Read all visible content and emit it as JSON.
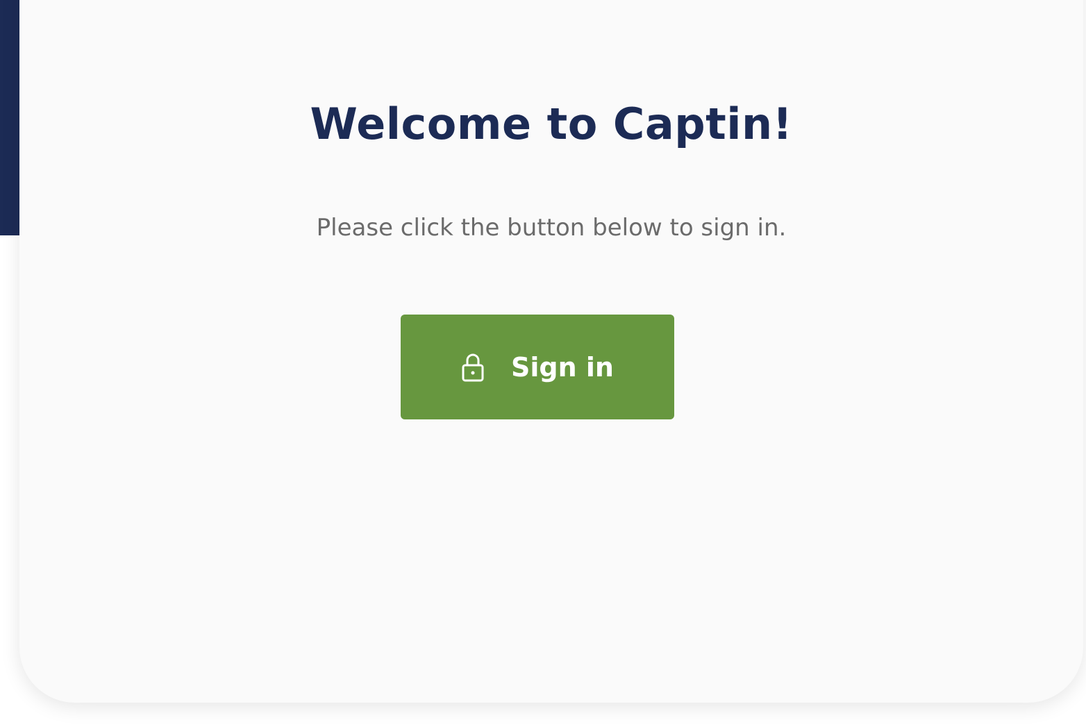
{
  "welcome": {
    "title": "Welcome to Captin!",
    "subtitle": "Please click the button below to sign in."
  },
  "signin": {
    "label": "Sign in",
    "icon": "lock-icon"
  },
  "colors": {
    "accent_navy": "#1c2b55",
    "button_green": "#67973f",
    "card_background": "#fafafa",
    "subtitle_gray": "#6b6b6b"
  }
}
